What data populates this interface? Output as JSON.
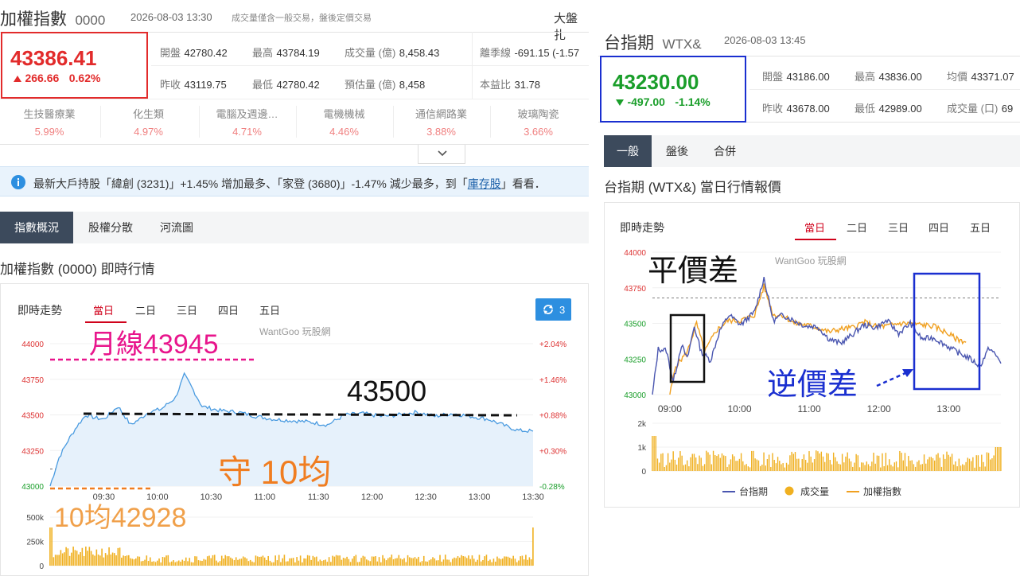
{
  "colors": {
    "up": "#e22b2b",
    "down": "#1a9e2a",
    "accent": "#3c4a5c",
    "series_blue": "#4a56b0",
    "series_orange": "#f0a020",
    "volume": "#f0b020"
  },
  "left": {
    "title": "加權指數",
    "code": "0000",
    "timestamp": "2026-08-03 13:30",
    "note": "成交量僅含一般交易，盤後定價交易",
    "overall_label": "大盤扎",
    "price": "43386.41",
    "change_icon": "triangle-up-icon",
    "change": "266.66",
    "change_pct": "0.62%",
    "stats": [
      {
        "label": "開盤",
        "value": "42780.42"
      },
      {
        "label": "最高",
        "value": "43784.19"
      },
      {
        "label": "成交量 (億)",
        "value": "8,458.43"
      },
      {
        "label": "離季線",
        "value": "-691.15 (-1.57"
      },
      {
        "label": "昨收",
        "value": "43119.75"
      },
      {
        "label": "最低",
        "value": "42780.42"
      },
      {
        "label": "預估量 (億)",
        "value": "8,458"
      },
      {
        "label": "本益比",
        "value": "31.78"
      }
    ],
    "sectors": [
      {
        "name": "生技醫療業",
        "pct": "5.99%"
      },
      {
        "name": "化生類",
        "pct": "4.97%"
      },
      {
        "name": "電腦及週邊…",
        "pct": "4.71%"
      },
      {
        "name": "電機機械",
        "pct": "4.46%"
      },
      {
        "name": "通信網路業",
        "pct": "3.88%"
      },
      {
        "name": "玻璃陶瓷",
        "pct": "3.66%"
      }
    ],
    "info": {
      "text_before": "最新大戶持股「緯創 (3231)」+1.45% 增加最多、「家登 (3680)」-1.47% 減少最多，到「",
      "link": "庫存股",
      "text_after": "」看看．"
    },
    "tabs": [
      "指數概況",
      "股權分散",
      "河流圖"
    ],
    "section_title": "加權指數 (0000) 即時行情",
    "chart_title": "即時走勢",
    "range_tabs": [
      "當日",
      "二日",
      "三日",
      "四日",
      "五日"
    ],
    "refresh_count": "3",
    "watermark": "WantGoo 玩股網",
    "annotations": {
      "monthly_line": "月線43945",
      "level": "43500",
      "hold": "守 10均",
      "ten_ma": "10均42928"
    }
  },
  "right": {
    "title": "台指期",
    "code": "WTX&",
    "timestamp": "2026-08-03 13:45",
    "price": "43230.00",
    "change_icon": "triangle-down-icon",
    "change": "-497.00",
    "change_pct": "-1.14%",
    "stats": [
      {
        "label": "開盤",
        "value": "43186.00"
      },
      {
        "label": "最高",
        "value": "43836.00"
      },
      {
        "label": "均價",
        "value": "43371.07"
      },
      {
        "label": "昨收",
        "value": "43678.00"
      },
      {
        "label": "最低",
        "value": "42989.00"
      },
      {
        "label": "成交量 (口)",
        "value": "69"
      }
    ],
    "tabs": [
      "一般",
      "盤後",
      "合併"
    ],
    "section_title": "台指期 (WTX&) 當日行情報價",
    "chart_title": "即時走勢",
    "range_tabs": [
      "當日",
      "二日",
      "三日",
      "四日",
      "五日"
    ],
    "watermark": "WantGoo 玩股網",
    "legend": [
      "台指期",
      "成交量",
      "加權指數"
    ],
    "annotations": {
      "parity": "平價差",
      "backwardation": "逆價差"
    }
  },
  "chart_data": [
    {
      "type": "area",
      "name": "",
      "x_ticks": [
        "09:30",
        "10:00",
        "10:30",
        "11:00",
        "11:30",
        "12:00",
        "12:30",
        "13:00",
        "13:30"
      ],
      "y_ticks": [
        "44000",
        "43750",
        "43500",
        "43250",
        "43000"
      ],
      "y_right_ticks": [
        "+2.04%",
        "+1.46%",
        "+0.88%",
        "+0.30%",
        "-0.28%"
      ],
      "ylim": [
        43000,
        44000
      ],
      "x_range": [
        "09:00",
        "13:30"
      ],
      "series": [
        {
          "values": [
            [
              0,
              43000
            ],
            [
              5,
              43200
            ],
            [
              10,
              43320
            ],
            [
              15,
              43420
            ],
            [
              20,
              43500
            ],
            [
              25,
              43480
            ],
            [
              30,
              43470
            ],
            [
              38,
              43560
            ],
            [
              45,
              43430
            ],
            [
              50,
              43470
            ],
            [
              55,
              43520
            ],
            [
              62,
              43540
            ],
            [
              70,
              43620
            ],
            [
              75,
              43780
            ],
            [
              78,
              43720
            ],
            [
              85,
              43560
            ],
            [
              95,
              43530
            ],
            [
              105,
              43520
            ],
            [
              115,
              43490
            ],
            [
              125,
              43470
            ],
            [
              135,
              43460
            ],
            [
              145,
              43450
            ],
            [
              155,
              43430
            ],
            [
              165,
              43500
            ],
            [
              175,
              43510
            ],
            [
              185,
              43490
            ],
            [
              195,
              43500
            ],
            [
              205,
              43520
            ],
            [
              215,
              43490
            ],
            [
              225,
              43510
            ],
            [
              235,
              43490
            ],
            [
              245,
              43470
            ],
            [
              255,
              43420
            ],
            [
              262,
              43390
            ],
            [
              270,
              43386
            ]
          ]
        }
      ],
      "volume_ticks": [
        "500k",
        "250k",
        "0"
      ],
      "reference_line": 43119.75
    },
    {
      "type": "line",
      "name": "",
      "x_ticks": [
        "09:00",
        "10:00",
        "11:00",
        "12:00",
        "13:00"
      ],
      "y_ticks": [
        "44000",
        "43750",
        "43500",
        "43250",
        "43000"
      ],
      "ylim": [
        43000,
        44000
      ],
      "x_range": [
        "08:45",
        "13:45"
      ],
      "series": [
        {
          "name": "台指期",
          "values": [
            [
              0,
              43000
            ],
            [
              5,
              43320
            ],
            [
              12,
              43310
            ],
            [
              18,
              43090
            ],
            [
              25,
              43350
            ],
            [
              30,
              43250
            ],
            [
              36,
              43480
            ],
            [
              42,
              43300
            ],
            [
              50,
              43240
            ],
            [
              58,
              43450
            ],
            [
              66,
              43560
            ],
            [
              76,
              43490
            ],
            [
              88,
              43580
            ],
            [
              96,
              43820
            ],
            [
              104,
              43520
            ],
            [
              112,
              43560
            ],
            [
              122,
              43520
            ],
            [
              132,
              43480
            ],
            [
              142,
              43480
            ],
            [
              152,
              43390
            ],
            [
              162,
              43360
            ],
            [
              172,
              43420
            ],
            [
              182,
              43490
            ],
            [
              192,
              43470
            ],
            [
              202,
              43520
            ],
            [
              212,
              43430
            ],
            [
              222,
              43500
            ],
            [
              232,
              43390
            ],
            [
              242,
              43400
            ],
            [
              252,
              43350
            ],
            [
              262,
              43300
            ],
            [
              272,
              43260
            ],
            [
              282,
              43200
            ],
            [
              290,
              43330
            ],
            [
              300,
              43230
            ]
          ]
        },
        {
          "name": "加權指數",
          "values": [
            [
              15,
              43000
            ],
            [
              20,
              43200
            ],
            [
              30,
              43300
            ],
            [
              38,
              43500
            ],
            [
              45,
              43300
            ],
            [
              55,
              43450
            ],
            [
              65,
              43520
            ],
            [
              76,
              43520
            ],
            [
              88,
              43560
            ],
            [
              96,
              43760
            ],
            [
              104,
              43560
            ],
            [
              112,
              43560
            ],
            [
              122,
              43500
            ],
            [
              132,
              43490
            ],
            [
              142,
              43470
            ],
            [
              152,
              43440
            ],
            [
              162,
              43460
            ],
            [
              172,
              43470
            ],
            [
              182,
              43510
            ],
            [
              192,
              43480
            ],
            [
              202,
              43480
            ],
            [
              212,
              43500
            ],
            [
              222,
              43500
            ],
            [
              232,
              43490
            ],
            [
              242,
              43480
            ],
            [
              252,
              43440
            ],
            [
              262,
              43390
            ],
            [
              270,
              43370
            ]
          ]
        }
      ],
      "volume_ticks": [
        "2k",
        "1k",
        "0"
      ],
      "reference_line": 43678
    }
  ]
}
